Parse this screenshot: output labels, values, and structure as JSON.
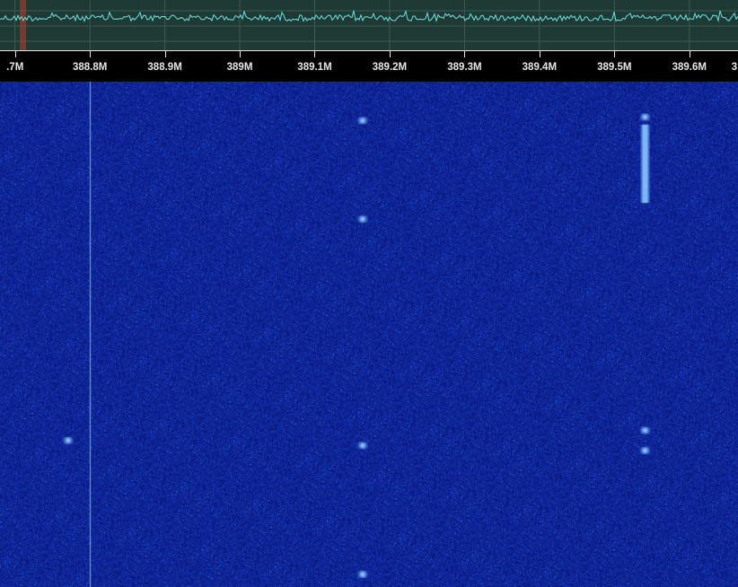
{
  "app": {
    "colors": {
      "spectrum_bg": "#1d3a35",
      "spectrum_trace": "#6fe3e0",
      "waterfall_bg": "#0a1a8a",
      "signal": "#7fc8ff",
      "axis_text": "#e6e6e6",
      "marker": "#c0392b"
    }
  },
  "spectrum": {
    "freq_start_mhz": 388.68,
    "freq_end_mhz": 389.665,
    "marker_freq_mhz": 388.71
  },
  "axis": {
    "labels": [
      {
        "freq": 388.7,
        "text": ".7M"
      },
      {
        "freq": 388.8,
        "text": "388.8M"
      },
      {
        "freq": 388.9,
        "text": "388.9M"
      },
      {
        "freq": 389.0,
        "text": "389M"
      },
      {
        "freq": 389.1,
        "text": "389.1M"
      },
      {
        "freq": 389.2,
        "text": "389.2M"
      },
      {
        "freq": 389.3,
        "text": "389.3M"
      },
      {
        "freq": 389.4,
        "text": "389.4M"
      },
      {
        "freq": 389.5,
        "text": "389.5M"
      },
      {
        "freq": 389.6,
        "text": "389.6M"
      },
      {
        "freq": 389.7,
        "text": "3"
      }
    ]
  },
  "waterfall": {
    "carrier_freq_mhz": 388.8,
    "bursts": [
      {
        "freq": 389.164,
        "row": 0.077
      },
      {
        "freq": 389.164,
        "row": 0.272
      },
      {
        "freq": 389.164,
        "row": 0.72
      },
      {
        "freq": 389.164,
        "row": 0.975
      },
      {
        "freq": 388.771,
        "row": 0.71
      },
      {
        "freq": 389.541,
        "row": 0.69
      },
      {
        "freq": 389.541,
        "row": 0.73
      },
      {
        "freq": 389.541,
        "row": 0.07
      }
    ],
    "long_signal": {
      "freq": 389.541,
      "row_start": 0.085,
      "row_end": 0.24
    }
  }
}
